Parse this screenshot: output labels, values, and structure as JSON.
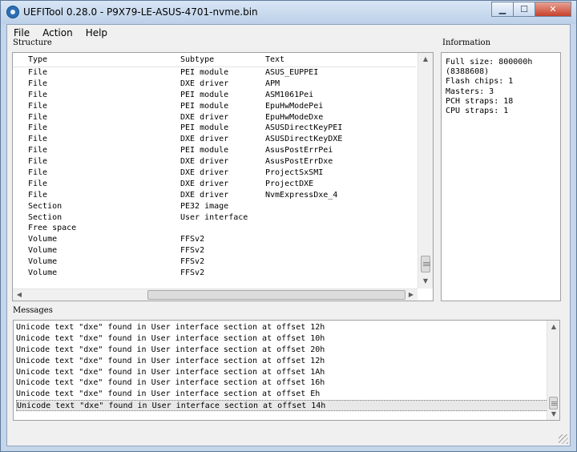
{
  "window": {
    "title": "UEFITool 0.28.0 - P9X79-LE-ASUS-4701-nvme.bin",
    "controls": {
      "minimize": "▁",
      "maximize": "☐",
      "close": "✕"
    }
  },
  "menu": [
    "File",
    "Action",
    "Help"
  ],
  "structure": {
    "label": "Structure",
    "columns": [
      "Type",
      "Subtype",
      "Text"
    ],
    "rows": [
      [
        "File",
        "PEI module",
        "ASUS_EUPPEI"
      ],
      [
        "File",
        "DXE driver",
        "APM"
      ],
      [
        "File",
        "PEI module",
        "ASM1061Pei"
      ],
      [
        "File",
        "PEI module",
        "EpuHwModePei"
      ],
      [
        "File",
        "DXE driver",
        "EpuHwModeDxe"
      ],
      [
        "File",
        "PEI module",
        "ASUSDirectKeyPEI"
      ],
      [
        "File",
        "DXE driver",
        "ASUSDirectKeyDXE"
      ],
      [
        "File",
        "PEI module",
        "AsusPostErrPei"
      ],
      [
        "File",
        "DXE driver",
        "AsusPostErrDxe"
      ],
      [
        "File",
        "DXE driver",
        "ProjectSxSMI"
      ],
      [
        "File",
        "DXE driver",
        "ProjectDXE"
      ],
      [
        "File",
        "DXE driver",
        "NvmExpressDxe_4"
      ],
      [
        "Section",
        "PE32 image",
        ""
      ],
      [
        "Section",
        "User interface",
        ""
      ],
      [
        "Free space",
        "",
        ""
      ],
      [
        "Volume",
        "FFSv2",
        ""
      ],
      [
        "Volume",
        "FFSv2",
        ""
      ],
      [
        "Volume",
        "FFSv2",
        ""
      ],
      [
        "Volume",
        "FFSv2",
        ""
      ]
    ]
  },
  "information": {
    "label": "Information",
    "lines": [
      "Full size: 800000h",
      "(8388608)",
      "Flash chips: 1",
      "Masters: 3",
      "PCH straps: 18",
      "CPU straps: 1"
    ]
  },
  "messages": {
    "label": "Messages",
    "items": [
      "Unicode text \"dxe\" found in User interface section at offset 12h",
      "Unicode text \"dxe\" found in User interface section at offset 10h",
      "Unicode text \"dxe\" found in User interface section at offset 20h",
      "Unicode text \"dxe\" found in User interface section at offset 12h",
      "Unicode text \"dxe\" found in User interface section at offset 1Ah",
      "Unicode text \"dxe\" found in User interface section at offset 16h",
      "Unicode text \"dxe\" found in User interface section at offset Eh",
      "Unicode text \"dxe\" found in User interface section at offset 14h"
    ],
    "selected_index": 7
  }
}
